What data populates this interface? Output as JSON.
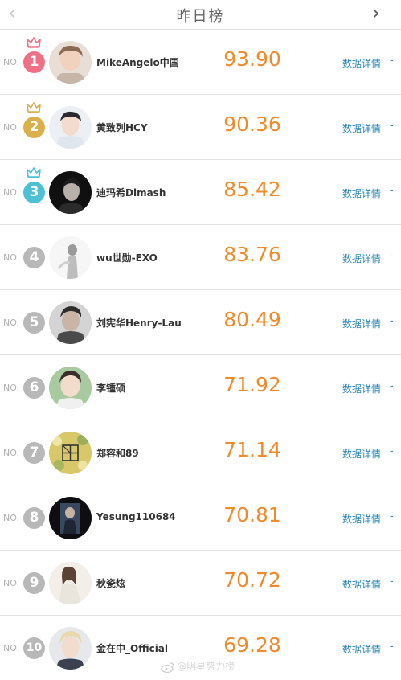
{
  "header": {
    "title": "昨日榜",
    "prev_symbol": "‹",
    "next_symbol": "›"
  },
  "colors": {
    "rank1": "#ee6f86",
    "rank2": "#d9b04a",
    "rank3": "#4fc0d4",
    "rank_other": "#b8b8b8",
    "score": "#f08b2c",
    "link": "#2a87b6"
  },
  "rows": [
    {
      "prefix": "NO.",
      "rank": "1",
      "name": "MikeAngelo中国",
      "score": "93.90",
      "detail": "数据详情",
      "dash": "-",
      "crown": "crown-icon-pink"
    },
    {
      "prefix": "NO.",
      "rank": "2",
      "name": "黄致列HCY",
      "score": "90.36",
      "detail": "数据详情",
      "dash": "-",
      "crown": "crown-icon-gold"
    },
    {
      "prefix": "NO.",
      "rank": "3",
      "name": "迪玛希Dimash",
      "score": "85.42",
      "detail": "数据详情",
      "dash": "-",
      "crown": "crown-icon-cyan"
    },
    {
      "prefix": "NO.",
      "rank": "4",
      "name": "wu世勋-EXO",
      "score": "83.76",
      "detail": "数据详情",
      "dash": "-"
    },
    {
      "prefix": "NO.",
      "rank": "5",
      "name": "刘宪华Henry-Lau",
      "score": "80.49",
      "detail": "数据详情",
      "dash": "-"
    },
    {
      "prefix": "NO.",
      "rank": "6",
      "name": "李锺硕",
      "score": "71.92",
      "detail": "数据详情",
      "dash": "-"
    },
    {
      "prefix": "NO.",
      "rank": "7",
      "name": "郑容和89",
      "score": "71.14",
      "detail": "数据详情",
      "dash": "-"
    },
    {
      "prefix": "NO.",
      "rank": "8",
      "name": "Yesung110684",
      "score": "70.81",
      "detail": "数据详情",
      "dash": "-"
    },
    {
      "prefix": "NO.",
      "rank": "9",
      "name": "秋瓷炫",
      "score": "70.72",
      "detail": "数据详情",
      "dash": "-"
    },
    {
      "prefix": "NO.",
      "rank": "10",
      "name": "金在中_Official",
      "score": "69.28",
      "detail": "数据详情",
      "dash": "-"
    }
  ],
  "watermark": {
    "text": "@明星势力榜",
    "icon": "weibo-icon"
  }
}
